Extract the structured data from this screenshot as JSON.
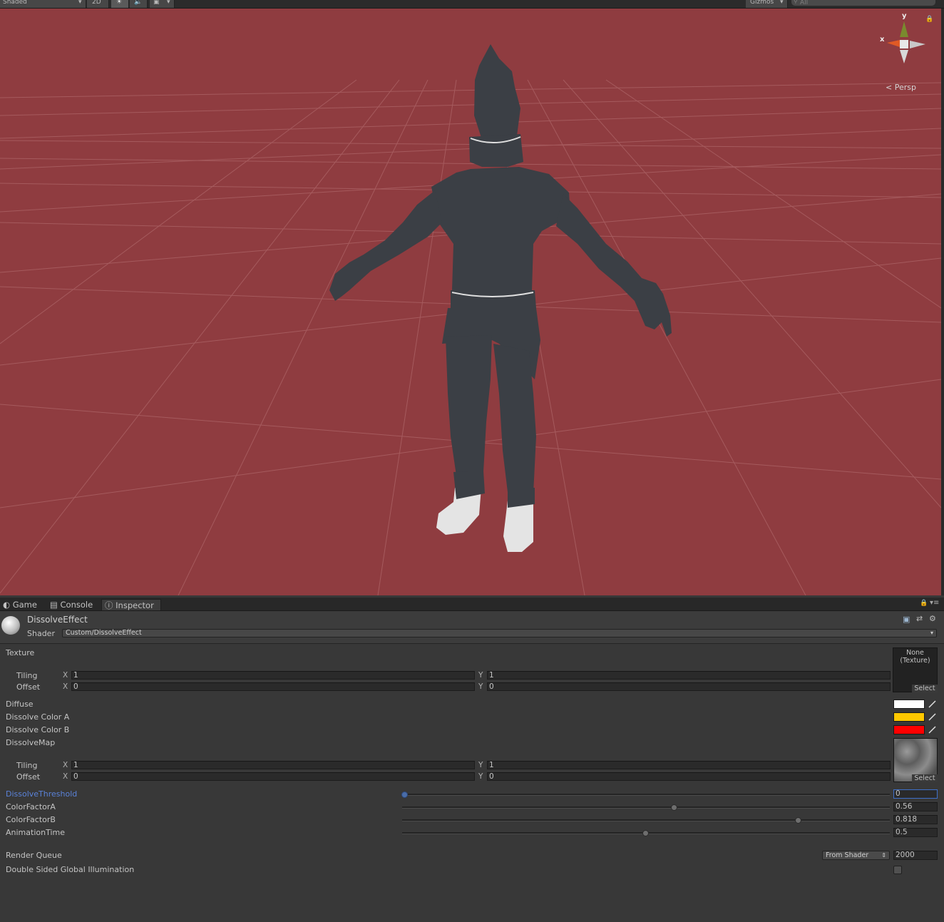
{
  "toolbar": {
    "shading_mode": "Shaded",
    "btn_2d": "2D",
    "gizmos_label": "Gizmos",
    "search_placeholder": "All"
  },
  "scene": {
    "background_color": "#8f3c40",
    "grid_color": "#b06a6c",
    "projection_label": "Persp",
    "gizmo_y": "y",
    "gizmo_x": "x"
  },
  "tabs": [
    {
      "label": "Game",
      "icon": "game-icon",
      "active": false
    },
    {
      "label": "Console",
      "icon": "console-icon",
      "active": false
    },
    {
      "label": "Inspector",
      "icon": "info-icon",
      "active": true
    }
  ],
  "material": {
    "name": "DissolveEffect",
    "shader_label": "Shader",
    "shader_value": "Custom/DissolveEffect"
  },
  "properties": {
    "texture": {
      "label": "Texture",
      "tiling_label": "Tiling",
      "offset_label": "Offset",
      "tiling_x": "1",
      "tiling_y": "1",
      "offset_x": "0",
      "offset_y": "0",
      "slot_text_1": "None",
      "slot_text_2": "(Texture)",
      "select_label": "Select"
    },
    "diffuse": {
      "label": "Diffuse",
      "color": "#ffffff"
    },
    "dissolve_color_a": {
      "label": "Dissolve Color A",
      "color": "#ffc800"
    },
    "dissolve_color_b": {
      "label": "Dissolve Color B",
      "color": "#ff0000"
    },
    "dissolve_map": {
      "label": "DissolveMap",
      "tiling_label": "Tiling",
      "offset_label": "Offset",
      "tiling_x": "1",
      "tiling_y": "1",
      "offset_x": "0",
      "offset_y": "0",
      "select_label": "Select"
    },
    "sliders": [
      {
        "label": "DissolveThreshold",
        "value": "0",
        "fraction": 0.0,
        "highlight": true
      },
      {
        "label": "ColorFactorA",
        "value": "0.56",
        "fraction": 0.56,
        "highlight": false
      },
      {
        "label": "ColorFactorB",
        "value": "0.818",
        "fraction": 0.818,
        "highlight": false
      },
      {
        "label": "AnimationTime",
        "value": "0.5",
        "fraction": 0.5,
        "highlight": false
      }
    ],
    "render_queue": {
      "label": "Render Queue",
      "mode": "From Shader",
      "value": "2000"
    },
    "double_sided_gi": {
      "label": "Double Sided Global Illumination",
      "checked": false
    }
  },
  "axis_labels": {
    "x": "X",
    "y": "Y"
  }
}
